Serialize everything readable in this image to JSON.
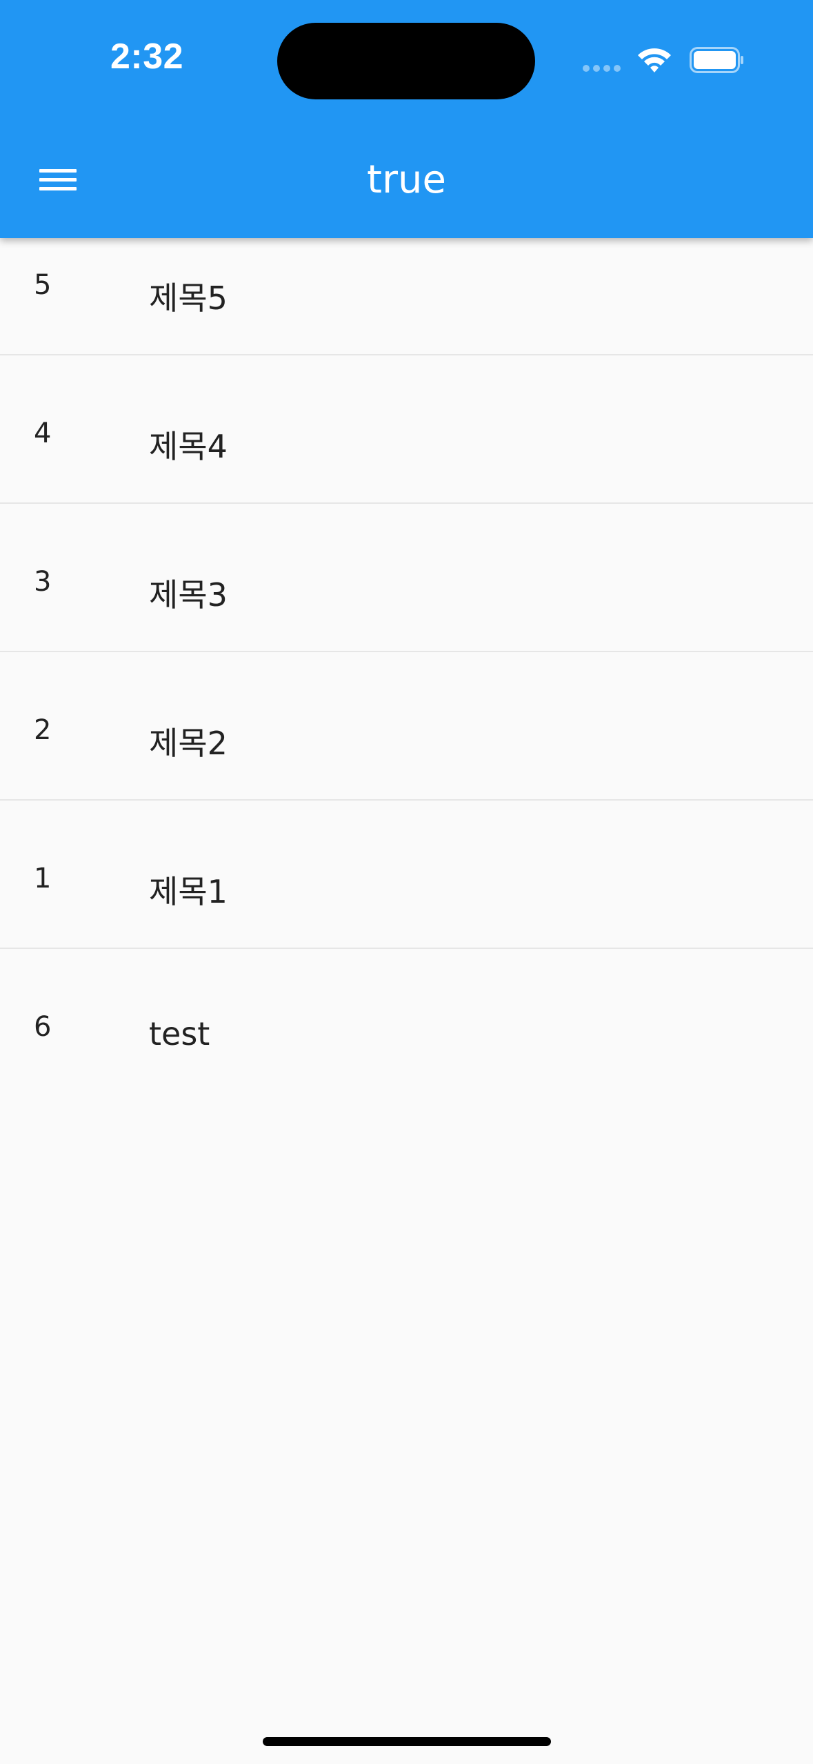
{
  "status_bar": {
    "time": "2:32",
    "icons": [
      "cellular-signal-icon",
      "wifi-icon",
      "battery-icon"
    ]
  },
  "app_bar": {
    "title": "true",
    "menu_icon": "hamburger-menu-icon",
    "background_color": "#2196f3"
  },
  "list": {
    "items": [
      {
        "id": "5",
        "title": "제목5"
      },
      {
        "id": "4",
        "title": "제목4"
      },
      {
        "id": "3",
        "title": "제목3"
      },
      {
        "id": "2",
        "title": "제목2"
      },
      {
        "id": "1",
        "title": "제목1"
      },
      {
        "id": "6",
        "title": "test"
      }
    ]
  }
}
